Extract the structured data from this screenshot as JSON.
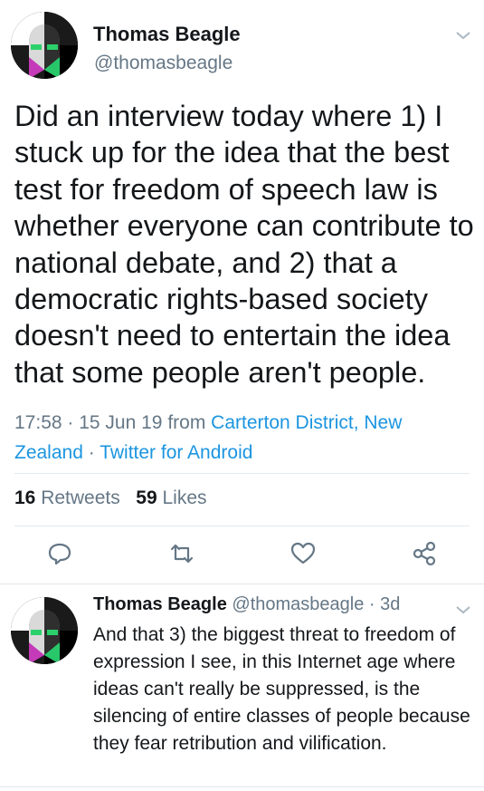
{
  "tweet": {
    "author_name": "Thomas Beagle",
    "author_handle": "@thomasbeagle",
    "text": "Did an interview today where 1) I stuck up for the idea that the best test for freedom of speech law is whether everyone can  contribute to national debate, and 2) that a democratic rights-based society doesn't need to entertain the idea that some people aren't people.",
    "time": "17:58",
    "date": "15 Jun 19",
    "from_label": "from",
    "location": "Carterton District, New Zealand",
    "client": "Twitter for Android",
    "retweets_count": "16",
    "retweets_label": "Retweets",
    "likes_count": "59",
    "likes_label": "Likes"
  },
  "reply": {
    "author_name": "Thomas Beagle",
    "author_handle": "@thomasbeagle",
    "age": "3d",
    "text": "And that 3) the biggest threat to freedom of expression I see, in this Internet age where ideas can't really be suppressed, is the silencing of entire classes of people because they fear retribution and vilification."
  },
  "icons": {
    "menu": "chevron-down-icon",
    "reply": "reply-icon",
    "retweet": "retweet-icon",
    "like": "heart-icon",
    "share": "share-icon"
  },
  "colors": {
    "link": "#1b95e0",
    "secondary_text": "#657786",
    "primary_text": "#14171a",
    "divider": "#e1e8ed"
  }
}
